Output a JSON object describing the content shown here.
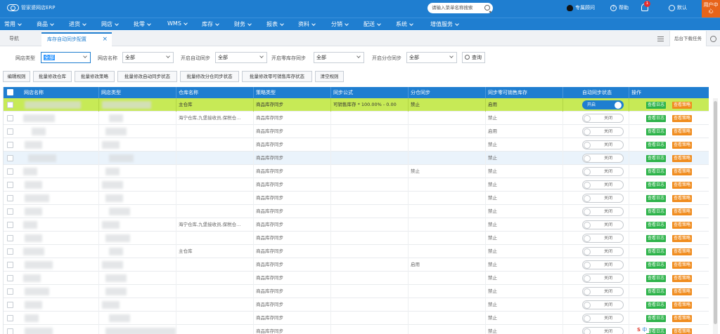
{
  "brand": "管家婆网店ERP",
  "search": {
    "placeholder": "请输入菜单名称搜索"
  },
  "header_right": {
    "service": "专属顾问",
    "help": "帮助",
    "notice_count": "1",
    "account": "默认",
    "user_menu": "用户中心"
  },
  "menu": [
    "常用",
    "商品",
    "进货",
    "网店",
    "批零",
    "WMS",
    "库存",
    "财务",
    "报表",
    "资料",
    "分销",
    "配送",
    "系统",
    "增值服务"
  ],
  "tabs": {
    "nav": "导航",
    "active": "库存自动同步配置",
    "download_task": "后台下载任务"
  },
  "filters": [
    {
      "label": "网店类型",
      "value": "全部"
    },
    {
      "label": "网店名称",
      "value": "全部"
    },
    {
      "label": "开启自动同步",
      "value": "全部"
    },
    {
      "label": "开启零库存同步",
      "value": "全部"
    },
    {
      "label": "开启分仓同步",
      "value": "全部"
    }
  ],
  "query_label": "查询",
  "actions": [
    "编辑规则",
    "批量修改仓库",
    "批量修改策略",
    "批量修改自动同步状态",
    "批量修改分仓同步状态",
    "批量修改零可销售库存状态",
    "清空规则"
  ],
  "columns": [
    "网店名称",
    "网店类型",
    "仓库名称",
    "策略类型",
    "同步公式",
    "分仓同步",
    "同步零可销售库存",
    "自动同步状态",
    "操作"
  ],
  "toggle_labels": {
    "on": "开启",
    "off": "关闭"
  },
  "op_labels": {
    "log": "查看日志",
    "strategy": "查看策略"
  },
  "rows": [
    {
      "warehouse": "主仓库",
      "strategy": "商品库存同步",
      "formula": "可销售库存 * 100.00% - 0.00",
      "split": "禁止",
      "zero": "启用",
      "on": true
    },
    {
      "warehouse": "海宁仓库,九堡接收员,保税仓...",
      "strategy": "商品库存同步",
      "formula": "",
      "split": "",
      "zero": "禁止",
      "on": false
    },
    {
      "warehouse": "",
      "strategy": "商品库存同步",
      "formula": "",
      "split": "",
      "zero": "启用",
      "on": false
    },
    {
      "warehouse": "",
      "strategy": "商品库存同步",
      "formula": "",
      "split": "",
      "zero": "禁止",
      "on": false
    },
    {
      "warehouse": "",
      "strategy": "商品库存同步",
      "formula": "",
      "split": "",
      "zero": "禁止",
      "on": false
    },
    {
      "warehouse": "",
      "strategy": "商品库存同步",
      "formula": "",
      "split": "禁止",
      "zero": "禁止",
      "on": false
    },
    {
      "warehouse": "",
      "strategy": "商品库存同步",
      "formula": "",
      "split": "",
      "zero": "禁止",
      "on": false
    },
    {
      "warehouse": "",
      "strategy": "商品库存同步",
      "formula": "",
      "split": "",
      "zero": "禁止",
      "on": false
    },
    {
      "warehouse": "",
      "strategy": "商品库存同步",
      "formula": "",
      "split": "",
      "zero": "禁止",
      "on": false
    },
    {
      "warehouse": "海宁仓库,九堡接收员,保税仓...",
      "strategy": "商品库存同步",
      "formula": "",
      "split": "",
      "zero": "禁止",
      "on": false
    },
    {
      "warehouse": "",
      "strategy": "商品库存同步",
      "formula": "",
      "split": "",
      "zero": "禁止",
      "on": false
    },
    {
      "warehouse": "主仓库",
      "strategy": "商品库存同步",
      "formula": "",
      "split": "",
      "zero": "禁止",
      "on": false
    },
    {
      "warehouse": "",
      "strategy": "商品库存同步",
      "formula": "",
      "split": "启用",
      "zero": "禁止",
      "on": false
    },
    {
      "warehouse": "",
      "strategy": "商品库存同步",
      "formula": "",
      "split": "",
      "zero": "禁止",
      "on": false
    },
    {
      "warehouse": "",
      "strategy": "商品库存同步",
      "formula": "",
      "split": "",
      "zero": "禁止",
      "on": false
    },
    {
      "warehouse": "",
      "strategy": "商品库存同步",
      "formula": "",
      "split": "",
      "zero": "禁止",
      "on": false
    },
    {
      "warehouse": "",
      "strategy": "商品库存同步",
      "formula": "",
      "split": "",
      "zero": "禁止",
      "on": false
    },
    {
      "warehouse": "",
      "strategy": "商品库存同步",
      "formula": "",
      "split": "",
      "zero": "禁止",
      "on": false
    }
  ],
  "ime": "中"
}
